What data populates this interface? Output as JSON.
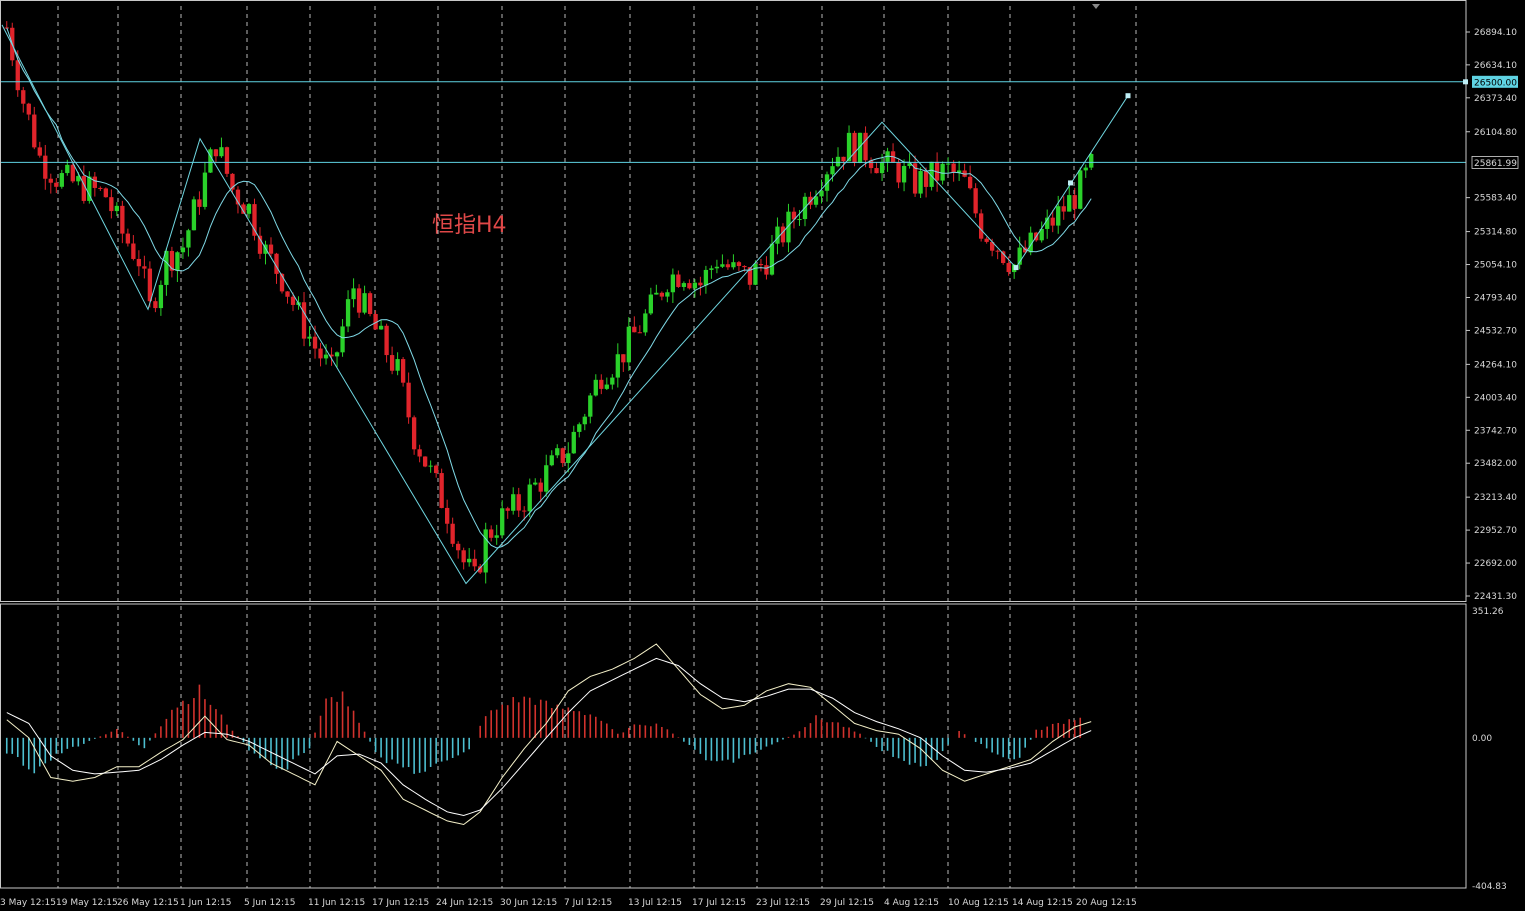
{
  "chart_data": {
    "type": "candlestick",
    "title": "恒指H4",
    "colors": {
      "background": "#000000",
      "up_candle": "#2ad12a",
      "down_candle": "#e0242b",
      "grid": "#d9d9d9",
      "ma_line": "#7fd9e6",
      "zigzag": "#6fd6e0",
      "hline": "#5fd3e3",
      "macd_pos": "#d2322d",
      "macd_neg": "#4dbfd0",
      "signal_line": "#ffffff",
      "axis_text": "#d8d8d8",
      "label_bg": "#5fd3e3"
    },
    "price_axis": {
      "min": 22431.3,
      "max": 26894.1,
      "ticks": [
        "26894.10",
        "26634.10",
        "26373.40",
        "26104.80",
        "25583.40",
        "25314.80",
        "25054.10",
        "24793.40",
        "24532.70",
        "24264.10",
        "24003.40",
        "23742.70",
        "23482.00",
        "23213.40",
        "22952.70",
        "22692.00",
        "22431.30"
      ]
    },
    "price_labels": {
      "hline_high": "26500.00",
      "hline_current": "25861.99"
    },
    "hlines": [
      26500.0,
      25862.0
    ],
    "zigzag_points": [
      {
        "x": "8 May 12:15",
        "y": 26950
      },
      {
        "x": "27 May 04:15",
        "y": 24700
      },
      {
        "x": "1 Jun 04:15",
        "y": 26050
      },
      {
        "x": "24 Jun 12:15",
        "y": 22530
      },
      {
        "x": "30 Jul 12:15",
        "y": 26180
      },
      {
        "x": "13 Aug 12:15",
        "y": 25030
      },
      {
        "x": "20 Aug 12:15",
        "y": 26390
      }
    ],
    "osc_axis": {
      "max_label": "351.26",
      "zero_label": "0.00",
      "min_label": "-404.83",
      "min": -404.83,
      "max": 351.26
    },
    "x_ticks": [
      "3 May 12:15",
      "19 May 12:15",
      "26 May 12:15",
      "1 Jun 12:15",
      "5 Jun 12:15",
      "11 Jun 12:15",
      "17 Jun 12:15",
      "24 Jun 12:15",
      "30 Jun 12:15",
      "7 Jul 12:15",
      "13 Jul 12:15",
      "17 Jul 12:15",
      "23 Jul 12:15",
      "29 Jul 12:15",
      "4 Aug 12:15",
      "10 Aug 12:15",
      "14 Aug 12:15",
      "20 Aug 12:15"
    ],
    "grid": "vertical-dashed",
    "close_path": [
      [
        0,
        26930
      ],
      [
        3,
        26350
      ],
      [
        6,
        25900
      ],
      [
        9,
        25750
      ],
      [
        12,
        25700
      ],
      [
        15,
        25650
      ],
      [
        18,
        25600
      ],
      [
        21,
        25300
      ],
      [
        24,
        25100
      ],
      [
        26,
        24700
      ],
      [
        29,
        25100
      ],
      [
        32,
        25200
      ],
      [
        35,
        25600
      ],
      [
        38,
        26020
      ],
      [
        41,
        25650
      ],
      [
        44,
        25500
      ],
      [
        47,
        25150
      ],
      [
        50,
        24950
      ],
      [
        53,
        24650
      ],
      [
        56,
        24400
      ],
      [
        59,
        24200
      ],
      [
        61,
        24550
      ],
      [
        63,
        24880
      ],
      [
        65,
        24700
      ],
      [
        68,
        24450
      ],
      [
        71,
        24200
      ],
      [
        74,
        23700
      ],
      [
        77,
        23400
      ],
      [
        80,
        23100
      ],
      [
        83,
        22700
      ],
      [
        85,
        22550
      ],
      [
        87,
        22900
      ],
      [
        90,
        23050
      ],
      [
        93,
        23150
      ],
      [
        96,
        23300
      ],
      [
        99,
        23450
      ],
      [
        102,
        23600
      ],
      [
        105,
        23900
      ],
      [
        108,
        24200
      ],
      [
        111,
        24300
      ],
      [
        114,
        24500
      ],
      [
        117,
        24700
      ],
      [
        120,
        24950
      ],
      [
        123,
        25000
      ],
      [
        126,
        24900
      ],
      [
        129,
        25100
      ],
      [
        132,
        25000
      ],
      [
        135,
        24950
      ],
      [
        138,
        25100
      ],
      [
        141,
        25300
      ],
      [
        144,
        25500
      ],
      [
        147,
        25700
      ],
      [
        150,
        25900
      ],
      [
        153,
        26000
      ],
      [
        156,
        25950
      ],
      [
        159,
        25850
      ],
      [
        162,
        25800
      ],
      [
        165,
        25700
      ],
      [
        168,
        25750
      ],
      [
        171,
        25800
      ],
      [
        174,
        25700
      ],
      [
        177,
        25350
      ],
      [
        180,
        25200
      ],
      [
        183,
        25050
      ],
      [
        185,
        25150
      ],
      [
        188,
        25300
      ],
      [
        191,
        25450
      ],
      [
        194,
        25600
      ],
      [
        197,
        25820
      ]
    ],
    "macd_hist": [
      [
        0,
        -40
      ],
      [
        5,
        -90
      ],
      [
        10,
        -40
      ],
      [
        15,
        -10
      ],
      [
        20,
        25
      ],
      [
        25,
        -30
      ],
      [
        30,
        80
      ],
      [
        35,
        130
      ],
      [
        40,
        40
      ],
      [
        45,
        -50
      ],
      [
        50,
        -90
      ],
      [
        55,
        -30
      ],
      [
        58,
        100
      ],
      [
        61,
        120
      ],
      [
        64,
        40
      ],
      [
        68,
        -60
      ],
      [
        72,
        -80
      ],
      [
        76,
        -100
      ],
      [
        80,
        -60
      ],
      [
        84,
        -30
      ],
      [
        87,
        60
      ],
      [
        91,
        100
      ],
      [
        95,
        110
      ],
      [
        99,
        85
      ],
      [
        103,
        80
      ],
      [
        107,
        60
      ],
      [
        111,
        10
      ],
      [
        115,
        40
      ],
      [
        119,
        35
      ],
      [
        123,
        -10
      ],
      [
        127,
        -60
      ],
      [
        131,
        -70
      ],
      [
        135,
        -45
      ],
      [
        139,
        -20
      ],
      [
        143,
        10
      ],
      [
        147,
        55
      ],
      [
        151,
        40
      ],
      [
        155,
        10
      ],
      [
        159,
        -35
      ],
      [
        163,
        -60
      ],
      [
        167,
        -85
      ],
      [
        170,
        -40
      ],
      [
        173,
        20
      ],
      [
        177,
        -20
      ],
      [
        181,
        -60
      ],
      [
        184,
        -55
      ],
      [
        187,
        20
      ],
      [
        191,
        40
      ],
      [
        195,
        60
      ],
      [
        197,
        40
      ]
    ],
    "macd_line": [
      [
        0,
        50
      ],
      [
        4,
        0
      ],
      [
        8,
        -110
      ],
      [
        12,
        -120
      ],
      [
        16,
        -110
      ],
      [
        20,
        -80
      ],
      [
        24,
        -80
      ],
      [
        28,
        -40
      ],
      [
        32,
        -5
      ],
      [
        36,
        60
      ],
      [
        40,
        -5
      ],
      [
        44,
        -20
      ],
      [
        48,
        -70
      ],
      [
        52,
        -100
      ],
      [
        56,
        -130
      ],
      [
        60,
        -10
      ],
      [
        64,
        -50
      ],
      [
        68,
        -90
      ],
      [
        72,
        -170
      ],
      [
        76,
        -200
      ],
      [
        80,
        -230
      ],
      [
        83,
        -240
      ],
      [
        86,
        -205
      ],
      [
        90,
        -110
      ],
      [
        94,
        -30
      ],
      [
        98,
        40
      ],
      [
        102,
        130
      ],
      [
        106,
        170
      ],
      [
        110,
        190
      ],
      [
        114,
        220
      ],
      [
        118,
        260
      ],
      [
        122,
        190
      ],
      [
        126,
        120
      ],
      [
        130,
        80
      ],
      [
        134,
        90
      ],
      [
        138,
        130
      ],
      [
        142,
        150
      ],
      [
        146,
        140
      ],
      [
        150,
        90
      ],
      [
        154,
        40
      ],
      [
        158,
        20
      ],
      [
        162,
        10
      ],
      [
        166,
        -30
      ],
      [
        170,
        -90
      ],
      [
        174,
        -120
      ],
      [
        178,
        -100
      ],
      [
        182,
        -80
      ],
      [
        186,
        -60
      ],
      [
        190,
        -10
      ],
      [
        194,
        30
      ],
      [
        197,
        45
      ]
    ],
    "signal_line": [
      [
        0,
        70
      ],
      [
        4,
        40
      ],
      [
        8,
        -50
      ],
      [
        12,
        -90
      ],
      [
        16,
        -100
      ],
      [
        20,
        -95
      ],
      [
        24,
        -90
      ],
      [
        28,
        -60
      ],
      [
        32,
        -20
      ],
      [
        36,
        15
      ],
      [
        40,
        10
      ],
      [
        44,
        -10
      ],
      [
        48,
        -40
      ],
      [
        52,
        -70
      ],
      [
        56,
        -100
      ],
      [
        60,
        -50
      ],
      [
        64,
        -45
      ],
      [
        68,
        -70
      ],
      [
        72,
        -130
      ],
      [
        76,
        -170
      ],
      [
        80,
        -205
      ],
      [
        83,
        -215
      ],
      [
        86,
        -200
      ],
      [
        90,
        -140
      ],
      [
        94,
        -70
      ],
      [
        98,
        0
      ],
      [
        102,
        70
      ],
      [
        106,
        130
      ],
      [
        110,
        160
      ],
      [
        114,
        190
      ],
      [
        118,
        220
      ],
      [
        122,
        200
      ],
      [
        126,
        150
      ],
      [
        130,
        110
      ],
      [
        134,
        100
      ],
      [
        138,
        115
      ],
      [
        142,
        135
      ],
      [
        146,
        135
      ],
      [
        150,
        110
      ],
      [
        154,
        70
      ],
      [
        158,
        45
      ],
      [
        162,
        25
      ],
      [
        166,
        0
      ],
      [
        170,
        -50
      ],
      [
        174,
        -90
      ],
      [
        178,
        -95
      ],
      [
        182,
        -85
      ],
      [
        186,
        -70
      ],
      [
        190,
        -35
      ],
      [
        194,
        0
      ],
      [
        197,
        20
      ]
    ]
  }
}
